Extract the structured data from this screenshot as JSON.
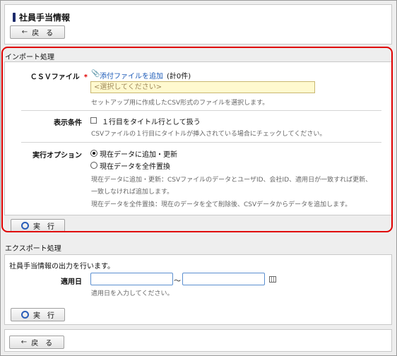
{
  "page": {
    "title": "社員手当情報"
  },
  "nav": {
    "back_label": "戻　る"
  },
  "import": {
    "section_title": "インポート処理",
    "csv_label": "ＣＳＶファイル",
    "required_mark": "*",
    "add_file_link": "添付ファイルを追加",
    "file_count": "(計0件)",
    "select_placeholder": "<選択してください>",
    "csv_hint": "セットアップ用に作成したCSV形式のファイルを選択します。",
    "display_label": "表示条件",
    "title_row_option": "１行目をタイトル行として扱う",
    "title_row_hint": "CSVファイルの１行目にタイトルが挿入されている場合にチェックしてください。",
    "exec_option_label": "実行オプション",
    "option_append": "現在データに追加・更新",
    "option_replace": "現在データを全件置換",
    "append_hint_1": "現在データに追加・更新：CSVファイルのデータとユーザID、会社ID、適用日が一致すれば更新、",
    "append_hint_2": "一致しなければ追加します。",
    "replace_hint": "現在データを全件置換：現在のデータを全て削除後、CSVデータからデータを追加します。",
    "run_label": "実　行"
  },
  "export": {
    "section_title": "エクスポート処理",
    "description": "社員手当情報の出力を行います。",
    "date_label": "適用日",
    "range_sep": "～",
    "date_hint": "適用日を入力してください。",
    "run_label": "実　行"
  },
  "icons": {
    "back": "arrow-left-icon",
    "run": "circle-icon",
    "attach": "paperclip-icon",
    "calendar": "calendar-icon"
  },
  "colors": {
    "required": "#e00000",
    "link": "#1d5bb8",
    "highlight_border": "#e00000"
  }
}
